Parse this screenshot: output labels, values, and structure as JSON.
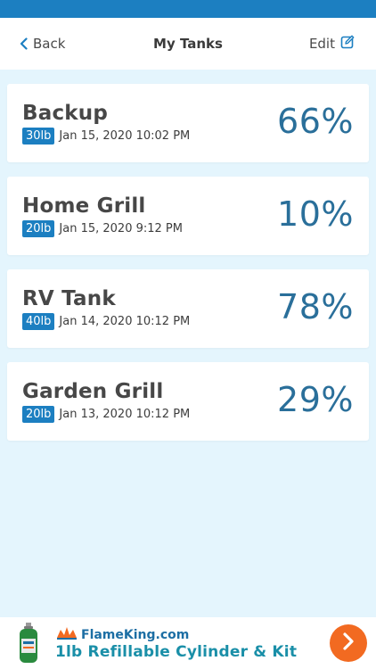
{
  "nav": {
    "back_label": "Back",
    "title": "My Tanks",
    "edit_label": "Edit"
  },
  "tanks": [
    {
      "name": "Backup",
      "size": "30lb",
      "date": "Jan 15, 2020 10:02 PM",
      "percent": "66%"
    },
    {
      "name": "Home Grill",
      "size": "20lb",
      "date": "Jan 15, 2020 9:12 PM",
      "percent": "10%"
    },
    {
      "name": "RV Tank",
      "size": "40lb",
      "date": "Jan 14, 2020 10:12 PM",
      "percent": "78%"
    },
    {
      "name": "Garden Grill",
      "size": "20lb",
      "date": "Jan 13, 2020 10:12 PM",
      "percent": "29%"
    }
  ],
  "ad": {
    "brand": "FlameKing.com",
    "tagline": "1lb Refillable Cylinder & Kit"
  },
  "colors": {
    "accent": "#1c7fc1",
    "background": "#e4f5fd",
    "percent_text": "#2a6f9a",
    "ad_button": "#f26a21"
  },
  "icons": {
    "back": "chevron-left-icon",
    "edit": "edit-icon",
    "ad_arrow": "chevron-right-icon"
  }
}
